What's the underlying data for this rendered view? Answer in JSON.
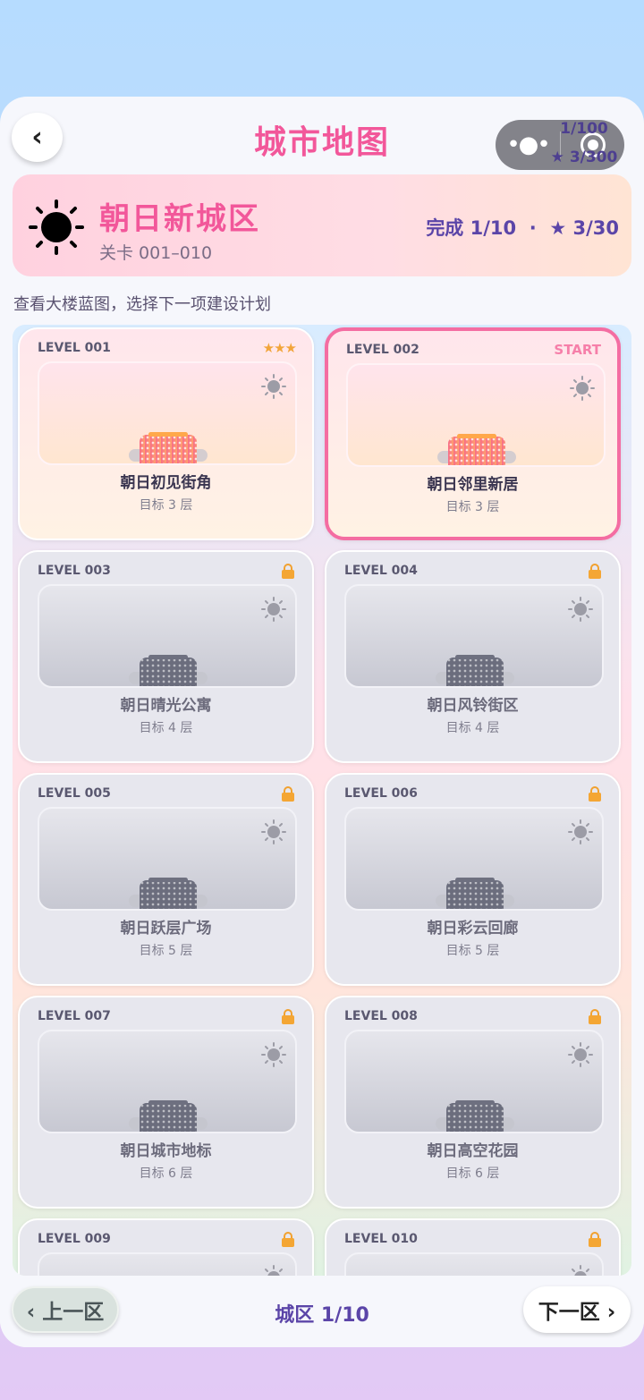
{
  "header": {
    "back_label": "‹",
    "title": "城市地图",
    "progress_overlay": "1/100",
    "stars_overlay": "★ 3/300"
  },
  "district": {
    "name": "朝日新城区",
    "range": "关卡 001–010",
    "stats": "完成 1/10  ·  ★ 3/30"
  },
  "hint": "查看大楼蓝图，选择下一项建设计划",
  "levels": [
    {
      "level": "LEVEL 001",
      "name": "朝日初见街角",
      "goal": "目标 3 层",
      "status": "completed",
      "stars": "★★★"
    },
    {
      "level": "LEVEL 002",
      "name": "朝日邻里新居",
      "goal": "目标 3 层",
      "status": "current",
      "tag": "START"
    },
    {
      "level": "LEVEL 003",
      "name": "朝日晴光公寓",
      "goal": "目标 4 层",
      "status": "locked"
    },
    {
      "level": "LEVEL 004",
      "name": "朝日风铃街区",
      "goal": "目标 4 层",
      "status": "locked"
    },
    {
      "level": "LEVEL 005",
      "name": "朝日跃层广场",
      "goal": "目标 5 层",
      "status": "locked"
    },
    {
      "level": "LEVEL 006",
      "name": "朝日彩云回廊",
      "goal": "目标 5 层",
      "status": "locked"
    },
    {
      "level": "LEVEL 007",
      "name": "朝日城市地标",
      "goal": "目标 6 层",
      "status": "locked"
    },
    {
      "level": "LEVEL 008",
      "name": "朝日高空花园",
      "goal": "目标 6 层",
      "status": "locked"
    },
    {
      "level": "LEVEL 009",
      "name": "",
      "goal": "",
      "status": "locked"
    },
    {
      "level": "LEVEL 010",
      "name": "",
      "goal": "",
      "status": "locked"
    }
  ],
  "footer": {
    "prev_label": "‹ 上一区",
    "page_indicator": "城区 1/10",
    "next_label": "下一区 ›"
  },
  "colors": {
    "accent_pink": "#f2579a",
    "accent_purple": "#5b45a8",
    "star_gold": "#f2a53a",
    "lock_orange": "#f4a634"
  }
}
